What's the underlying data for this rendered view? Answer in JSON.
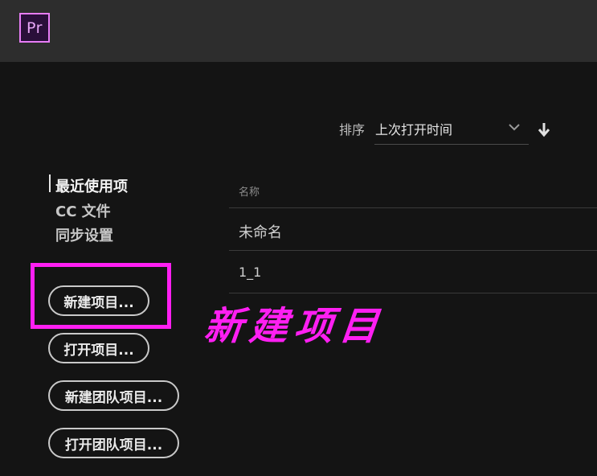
{
  "app": {
    "logo_text": "Pr"
  },
  "sort": {
    "label": "排序",
    "value": "上次打开时间"
  },
  "nav": {
    "items": [
      {
        "label": "最近使用项"
      },
      {
        "label": "CC 文件"
      },
      {
        "label": "同步设置"
      }
    ]
  },
  "buttons": {
    "new_project": "新建项目...",
    "open_project": "打开项目...",
    "new_team_project": "新建团队项目...",
    "open_team_project": "打开团队项目..."
  },
  "file_list": {
    "header": "名称",
    "rows": [
      {
        "name": "未命名"
      },
      {
        "name": "1_1"
      }
    ]
  },
  "annotation": {
    "text": "新建项目"
  },
  "colors": {
    "accent_magenta": "#ff1ff2",
    "pr_logo": "#e77cf6"
  }
}
